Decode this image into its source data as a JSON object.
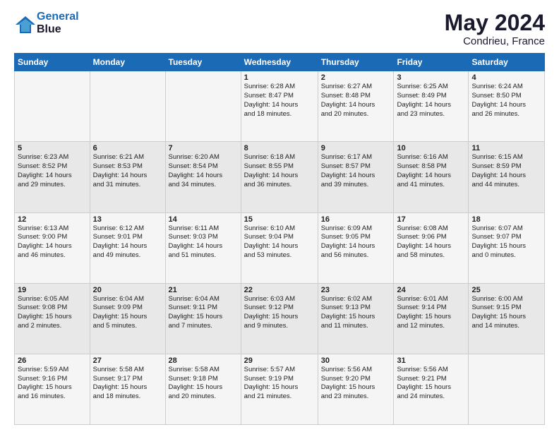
{
  "header": {
    "logo_line1": "General",
    "logo_line2": "Blue",
    "month": "May 2024",
    "location": "Condrieu, France"
  },
  "weekdays": [
    "Sunday",
    "Monday",
    "Tuesday",
    "Wednesday",
    "Thursday",
    "Friday",
    "Saturday"
  ],
  "weeks": [
    [
      {
        "day": "",
        "info": ""
      },
      {
        "day": "",
        "info": ""
      },
      {
        "day": "",
        "info": ""
      },
      {
        "day": "1",
        "info": "Sunrise: 6:28 AM\nSunset: 8:47 PM\nDaylight: 14 hours\nand 18 minutes."
      },
      {
        "day": "2",
        "info": "Sunrise: 6:27 AM\nSunset: 8:48 PM\nDaylight: 14 hours\nand 20 minutes."
      },
      {
        "day": "3",
        "info": "Sunrise: 6:25 AM\nSunset: 8:49 PM\nDaylight: 14 hours\nand 23 minutes."
      },
      {
        "day": "4",
        "info": "Sunrise: 6:24 AM\nSunset: 8:50 PM\nDaylight: 14 hours\nand 26 minutes."
      }
    ],
    [
      {
        "day": "5",
        "info": "Sunrise: 6:23 AM\nSunset: 8:52 PM\nDaylight: 14 hours\nand 29 minutes."
      },
      {
        "day": "6",
        "info": "Sunrise: 6:21 AM\nSunset: 8:53 PM\nDaylight: 14 hours\nand 31 minutes."
      },
      {
        "day": "7",
        "info": "Sunrise: 6:20 AM\nSunset: 8:54 PM\nDaylight: 14 hours\nand 34 minutes."
      },
      {
        "day": "8",
        "info": "Sunrise: 6:18 AM\nSunset: 8:55 PM\nDaylight: 14 hours\nand 36 minutes."
      },
      {
        "day": "9",
        "info": "Sunrise: 6:17 AM\nSunset: 8:57 PM\nDaylight: 14 hours\nand 39 minutes."
      },
      {
        "day": "10",
        "info": "Sunrise: 6:16 AM\nSunset: 8:58 PM\nDaylight: 14 hours\nand 41 minutes."
      },
      {
        "day": "11",
        "info": "Sunrise: 6:15 AM\nSunset: 8:59 PM\nDaylight: 14 hours\nand 44 minutes."
      }
    ],
    [
      {
        "day": "12",
        "info": "Sunrise: 6:13 AM\nSunset: 9:00 PM\nDaylight: 14 hours\nand 46 minutes."
      },
      {
        "day": "13",
        "info": "Sunrise: 6:12 AM\nSunset: 9:01 PM\nDaylight: 14 hours\nand 49 minutes."
      },
      {
        "day": "14",
        "info": "Sunrise: 6:11 AM\nSunset: 9:03 PM\nDaylight: 14 hours\nand 51 minutes."
      },
      {
        "day": "15",
        "info": "Sunrise: 6:10 AM\nSunset: 9:04 PM\nDaylight: 14 hours\nand 53 minutes."
      },
      {
        "day": "16",
        "info": "Sunrise: 6:09 AM\nSunset: 9:05 PM\nDaylight: 14 hours\nand 56 minutes."
      },
      {
        "day": "17",
        "info": "Sunrise: 6:08 AM\nSunset: 9:06 PM\nDaylight: 14 hours\nand 58 minutes."
      },
      {
        "day": "18",
        "info": "Sunrise: 6:07 AM\nSunset: 9:07 PM\nDaylight: 15 hours\nand 0 minutes."
      }
    ],
    [
      {
        "day": "19",
        "info": "Sunrise: 6:05 AM\nSunset: 9:08 PM\nDaylight: 15 hours\nand 2 minutes."
      },
      {
        "day": "20",
        "info": "Sunrise: 6:04 AM\nSunset: 9:09 PM\nDaylight: 15 hours\nand 5 minutes."
      },
      {
        "day": "21",
        "info": "Sunrise: 6:04 AM\nSunset: 9:11 PM\nDaylight: 15 hours\nand 7 minutes."
      },
      {
        "day": "22",
        "info": "Sunrise: 6:03 AM\nSunset: 9:12 PM\nDaylight: 15 hours\nand 9 minutes."
      },
      {
        "day": "23",
        "info": "Sunrise: 6:02 AM\nSunset: 9:13 PM\nDaylight: 15 hours\nand 11 minutes."
      },
      {
        "day": "24",
        "info": "Sunrise: 6:01 AM\nSunset: 9:14 PM\nDaylight: 15 hours\nand 12 minutes."
      },
      {
        "day": "25",
        "info": "Sunrise: 6:00 AM\nSunset: 9:15 PM\nDaylight: 15 hours\nand 14 minutes."
      }
    ],
    [
      {
        "day": "26",
        "info": "Sunrise: 5:59 AM\nSunset: 9:16 PM\nDaylight: 15 hours\nand 16 minutes."
      },
      {
        "day": "27",
        "info": "Sunrise: 5:58 AM\nSunset: 9:17 PM\nDaylight: 15 hours\nand 18 minutes."
      },
      {
        "day": "28",
        "info": "Sunrise: 5:58 AM\nSunset: 9:18 PM\nDaylight: 15 hours\nand 20 minutes."
      },
      {
        "day": "29",
        "info": "Sunrise: 5:57 AM\nSunset: 9:19 PM\nDaylight: 15 hours\nand 21 minutes."
      },
      {
        "day": "30",
        "info": "Sunrise: 5:56 AM\nSunset: 9:20 PM\nDaylight: 15 hours\nand 23 minutes."
      },
      {
        "day": "31",
        "info": "Sunrise: 5:56 AM\nSunset: 9:21 PM\nDaylight: 15 hours\nand 24 minutes."
      },
      {
        "day": "",
        "info": ""
      }
    ]
  ]
}
